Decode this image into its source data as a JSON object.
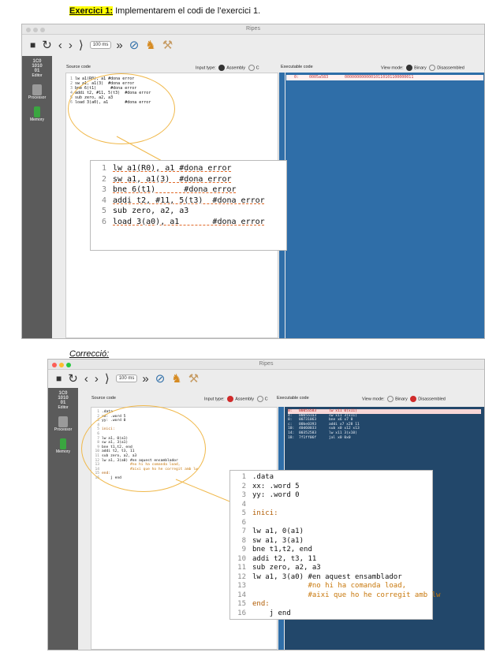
{
  "header1": {
    "highlight": "Exercici 1:",
    "text": " Implementarem el codi de l’exercici 1."
  },
  "header2": "Correcció:",
  "window_title": "Ripes",
  "speed": "100 ms",
  "sidebar": {
    "editor": "Editor",
    "processor": "Processor",
    "memory": "Memory",
    "logo": "1C0\n1010\n01"
  },
  "source_code_label": "Source code",
  "input_type_label": "Input type:",
  "assembly": "Assembly",
  "c_label": "C",
  "executable_code": "Executable code",
  "view_mode_label": "View mode:",
  "binary": "Binary",
  "disassembled": "Disassembled",
  "ex1": {
    "lines": [
      {
        "n": "1",
        "code": "lw a1(R0), a1 #dona error"
      },
      {
        "n": "2",
        "code": "sw a1, a1(3)  #dona error"
      },
      {
        "n": "3",
        "code": "bne 6(t1)      #dona error"
      },
      {
        "n": "4",
        "code": "addi t2, #11, 5(t3)  #dona error"
      },
      {
        "n": "5",
        "code": "sub zero, a2, a3"
      },
      {
        "n": "6",
        "code": "load 3(a0), a1       #dona error"
      }
    ],
    "exec": {
      "addr": "0:",
      "hex": "0005a583",
      "bin": "00000000000010110101100000011"
    }
  },
  "ex2": {
    "lines": [
      {
        "n": "1",
        "code": ".data",
        "cls": ""
      },
      {
        "n": "2",
        "code": "xx: .word 5",
        "cls": ""
      },
      {
        "n": "3",
        "code": "yy: .word 0",
        "cls": ""
      },
      {
        "n": "4",
        "code": "",
        "cls": ""
      },
      {
        "n": "5",
        "code": "inici:",
        "cls": "lbl"
      },
      {
        "n": "6",
        "code": "",
        "cls": ""
      },
      {
        "n": "7",
        "code": "lw a1, 0(a1)",
        "cls": ""
      },
      {
        "n": "8",
        "code": "sw a1, 3(a1)",
        "cls": ""
      },
      {
        "n": "9",
        "code": "bne t1,t2, end",
        "cls": ""
      },
      {
        "n": "10",
        "code": "addi t2, t3, 11",
        "cls": ""
      },
      {
        "n": "11",
        "code": "sub zero, a2, a3",
        "cls": ""
      },
      {
        "n": "12",
        "code": "lw a1, 3(a0) #en aquest ensamblador",
        "cls": ""
      },
      {
        "n": "13",
        "code": "             #no hi ha comanda load,",
        "cls": "cmt"
      },
      {
        "n": "14",
        "code": "             #aixi que ho he corregit amb lw",
        "cls": "cmt"
      },
      {
        "n": "15",
        "code": "end:",
        "cls": "lbl"
      },
      {
        "n": "16",
        "code": "    j end",
        "cls": ""
      }
    ],
    "exec": [
      {
        "a": "0:",
        "h": "0005a583",
        "d": "lw x11 0(x11)"
      },
      {
        "a": "4:",
        "h": "00b5a1a3",
        "d": "sw x11 3(x11)"
      },
      {
        "a": "8:",
        "h": "00731063",
        "d": "bne x6 x7 0"
      },
      {
        "a": "c:",
        "h": "00be0393",
        "d": "addi x7 x28 11"
      },
      {
        "a": "10:",
        "h": "40d60033",
        "d": "sub x0 x12 x13"
      },
      {
        "a": "14:",
        "h": "00352583",
        "d": "lw x11 3(x10)"
      },
      {
        "a": "18:",
        "h": "7f1ff06f",
        "d": "jal x0 0x0"
      }
    ]
  }
}
